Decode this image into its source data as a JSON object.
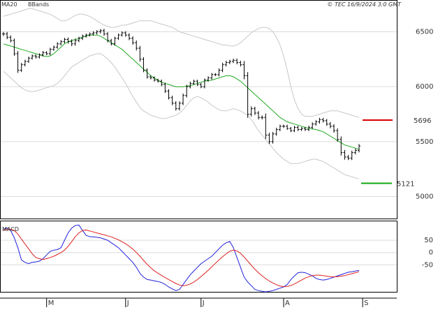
{
  "header": {
    "ma_label": "MA20",
    "bb_label": "BBands",
    "copyright": "© TEC 16/9/2024 3:0 GMT"
  },
  "colors": {
    "ma": "#22aa22",
    "bbands": "#c8c8c8",
    "candle": "#000000",
    "grid": "#dcdcdc",
    "macd_line": "#2222dd",
    "signal_line": "#dd2222",
    "resistance": "#dd0000",
    "support": "#11aa11"
  },
  "chart_data": [
    {
      "type": "candlestick",
      "title": "",
      "y_ticks": [
        {
          "value": 6500,
          "label": "6500"
        },
        {
          "value": 6000,
          "label": "6000"
        },
        {
          "value": 5500,
          "label": "5500"
        },
        {
          "value": 5000,
          "label": "5000"
        }
      ],
      "ylim": [
        4800,
        6700
      ],
      "x_months": [
        {
          "label": "M",
          "index": 12
        },
        {
          "label": "J",
          "index": 34
        },
        {
          "label": "J",
          "index": 55
        },
        {
          "label": "A",
          "index": 78
        },
        {
          "label": "S",
          "index": 100
        }
      ],
      "levels": [
        {
          "name": "resistance",
          "value": 5696,
          "label": "5696"
        },
        {
          "name": "support",
          "value": 5121,
          "label": "5121"
        }
      ],
      "close": [
        6480,
        6450,
        6420,
        6300,
        6150,
        6200,
        6230,
        6260,
        6280,
        6270,
        6290,
        6310,
        6300,
        6340,
        6360,
        6390,
        6410,
        6430,
        6410,
        6390,
        6420,
        6440,
        6460,
        6470,
        6480,
        6490,
        6500,
        6510,
        6480,
        6420,
        6390,
        6440,
        6470,
        6490,
        6470,
        6440,
        6400,
        6350,
        6250,
        6150,
        6090,
        6080,
        6060,
        6050,
        6020,
        5960,
        5900,
        5850,
        5800,
        5850,
        5920,
        6000,
        6030,
        6050,
        6020,
        6000,
        6060,
        6080,
        6110,
        6110,
        6150,
        6200,
        6220,
        6230,
        6240,
        6220,
        6200,
        6100,
        5750,
        5800,
        5760,
        5720,
        5720,
        5560,
        5500,
        5570,
        5610,
        5640,
        5640,
        5620,
        5600,
        5630,
        5610,
        5620,
        5610,
        5630,
        5660,
        5680,
        5700,
        5690,
        5660,
        5640,
        5600,
        5520,
        5400,
        5360,
        5350,
        5400,
        5420,
        5460
      ],
      "range": [
        60,
        60,
        55,
        60,
        80,
        55,
        50,
        45,
        45,
        45,
        45,
        50,
        45,
        45,
        45,
        50,
        50,
        50,
        60,
        70,
        55,
        50,
        50,
        45,
        45,
        50,
        50,
        50,
        55,
        55,
        50,
        50,
        45,
        45,
        50,
        55,
        60,
        70,
        70,
        60,
        55,
        45,
        45,
        40,
        50,
        55,
        55,
        60,
        60,
        55,
        60,
        60,
        50,
        45,
        45,
        45,
        50,
        50,
        50,
        45,
        55,
        60,
        55,
        50,
        50,
        55,
        55,
        110,
        110,
        70,
        60,
        60,
        60,
        120,
        70,
        60,
        55,
        50,
        50,
        45,
        45,
        45,
        45,
        45,
        45,
        50,
        50,
        50,
        55,
        55,
        55,
        60,
        60,
        70,
        90,
        80,
        60,
        60,
        55,
        60
      ],
      "ma20": [
        6390,
        6380,
        6370,
        6360,
        6350,
        6340,
        6330,
        6320,
        6310,
        6300,
        6290,
        6280,
        6275,
        6280,
        6300,
        6330,
        6360,
        6390,
        6410,
        6420,
        6430,
        6440,
        6450,
        6460,
        6470,
        6470,
        6470,
        6460,
        6440,
        6420,
        6400,
        6380,
        6360,
        6340,
        6310,
        6280,
        6250,
        6220,
        6190,
        6160,
        6130,
        6100,
        6080,
        6060,
        6040,
        6030,
        6020,
        6010,
        6000,
        6000,
        6000,
        6005,
        6010,
        6020,
        6030,
        6040,
        6050,
        6055,
        6060,
        6070,
        6080,
        6090,
        6100,
        6100,
        6090,
        6070,
        6050,
        6020,
        5990,
        5960,
        5930,
        5900,
        5870,
        5840,
        5810,
        5780,
        5750,
        5720,
        5700,
        5680,
        5670,
        5660,
        5650,
        5640,
        5630,
        5620,
        5615,
        5610,
        5600,
        5590,
        5570,
        5550,
        5530,
        5510,
        5490,
        5470,
        5460,
        5450,
        5440,
        5430
      ],
      "bb_upper": [
        6640,
        6650,
        6660,
        6670,
        6680,
        6690,
        6700,
        6710,
        6710,
        6700,
        6690,
        6680,
        6670,
        6660,
        6640,
        6620,
        6600,
        6600,
        6610,
        6630,
        6650,
        6660,
        6660,
        6650,
        6640,
        6620,
        6600,
        6580,
        6560,
        6550,
        6540,
        6540,
        6550,
        6560,
        6560,
        6570,
        6580,
        6590,
        6600,
        6600,
        6600,
        6600,
        6590,
        6580,
        6570,
        6560,
        6550,
        6540,
        6520,
        6500,
        6490,
        6480,
        6470,
        6460,
        6450,
        6440,
        6430,
        6420,
        6410,
        6400,
        6390,
        6380,
        6380,
        6370,
        6370,
        6380,
        6400,
        6430,
        6460,
        6490,
        6510,
        6530,
        6540,
        6540,
        6530,
        6500,
        6450,
        6380,
        6280,
        6150,
        6000,
        5880,
        5800,
        5750,
        5730,
        5730,
        5730,
        5740,
        5750,
        5760,
        5770,
        5780,
        5780,
        5780,
        5770,
        5760,
        5750,
        5740,
        5730,
        5720
      ],
      "bb_lower": [
        6140,
        6110,
        6080,
        6050,
        6020,
        5990,
        5970,
        5960,
        5955,
        5960,
        5970,
        5980,
        5990,
        6000,
        6010,
        6030,
        6060,
        6100,
        6140,
        6180,
        6200,
        6220,
        6240,
        6260,
        6280,
        6290,
        6300,
        6300,
        6280,
        6250,
        6220,
        6180,
        6130,
        6080,
        6030,
        5970,
        5910,
        5860,
        5810,
        5780,
        5760,
        5740,
        5730,
        5720,
        5710,
        5710,
        5720,
        5730,
        5740,
        5760,
        5790,
        5830,
        5870,
        5900,
        5910,
        5900,
        5880,
        5860,
        5830,
        5810,
        5790,
        5780,
        5780,
        5790,
        5800,
        5790,
        5780,
        5760,
        5740,
        5700,
        5650,
        5600,
        5560,
        5520,
        5480,
        5440,
        5400,
        5370,
        5340,
        5320,
        5300,
        5300,
        5300,
        5310,
        5320,
        5330,
        5340,
        5340,
        5330,
        5320,
        5300,
        5280,
        5260,
        5240,
        5220,
        5200,
        5190,
        5180,
        5170,
        5160
      ]
    },
    {
      "type": "line",
      "title": "MACD",
      "y_ticks": [
        {
          "value": 50,
          "label": "50"
        },
        {
          "value": 0,
          "label": "0"
        },
        {
          "value": -50,
          "label": "-50"
        }
      ],
      "ylim": [
        -160,
        130
      ],
      "series": [
        {
          "name": "macd",
          "values": [
            95,
            100,
            90,
            60,
            20,
            -30,
            -40,
            -45,
            -40,
            -38,
            -35,
            -25,
            -10,
            5,
            10,
            12,
            20,
            50,
            80,
            100,
            110,
            112,
            90,
            70,
            65,
            64,
            62,
            60,
            55,
            50,
            40,
            30,
            20,
            5,
            -10,
            -25,
            -40,
            -60,
            -85,
            -100,
            -110,
            -112,
            -115,
            -118,
            -122,
            -130,
            -140,
            -148,
            -155,
            -150,
            -130,
            -110,
            -90,
            -75,
            -60,
            -45,
            -35,
            -25,
            -15,
            0,
            15,
            30,
            40,
            45,
            20,
            -20,
            -60,
            -100,
            -120,
            -135,
            -150,
            -155,
            -158,
            -160,
            -158,
            -155,
            -150,
            -145,
            -140,
            -130,
            -110,
            -95,
            -82,
            -80,
            -82,
            -88,
            -95,
            -105,
            -110,
            -112,
            -110,
            -105,
            -100,
            -95,
            -90,
            -85,
            -80,
            -78,
            -75,
            -73
          ]
        },
        {
          "name": "signal",
          "values": [
            90,
            95,
            95,
            90,
            75,
            55,
            35,
            15,
            -5,
            -20,
            -25,
            -28,
            -25,
            -20,
            -15,
            -8,
            0,
            10,
            25,
            45,
            65,
            80,
            90,
            92,
            88,
            84,
            80,
            76,
            72,
            68,
            64,
            58,
            52,
            44,
            36,
            26,
            14,
            0,
            -15,
            -32,
            -48,
            -62,
            -74,
            -84,
            -93,
            -102,
            -110,
            -118,
            -126,
            -132,
            -135,
            -133,
            -128,
            -120,
            -110,
            -98,
            -85,
            -72,
            -58,
            -44,
            -30,
            -17,
            -5,
            5,
            10,
            7,
            -3,
            -18,
            -35,
            -52,
            -68,
            -82,
            -95,
            -106,
            -116,
            -124,
            -131,
            -136,
            -139,
            -138,
            -134,
            -128,
            -120,
            -112,
            -104,
            -98,
            -94,
            -92,
            -92,
            -94,
            -96,
            -98,
            -99,
            -98,
            -96,
            -94,
            -90,
            -86,
            -82,
            -78
          ]
        }
      ]
    }
  ]
}
